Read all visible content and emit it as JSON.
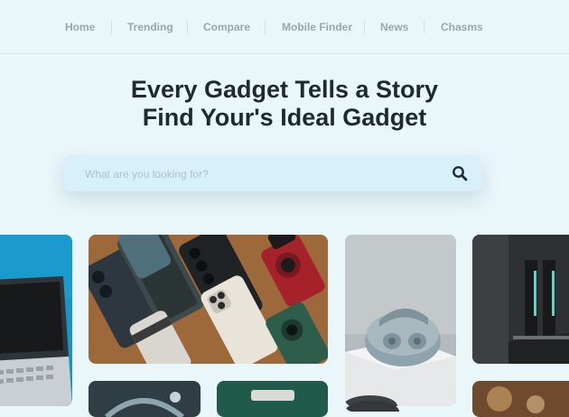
{
  "nav": {
    "items": [
      {
        "label": "Home"
      },
      {
        "label": "Trending"
      },
      {
        "label": "Compare"
      },
      {
        "label": "Mobile Finder"
      },
      {
        "label": "News"
      },
      {
        "label": "Chasms"
      }
    ]
  },
  "hero": {
    "line1": "Every Gadget Tells a Story",
    "line2": "Find Your's Ideal Gadget"
  },
  "search": {
    "placeholder": "What are you looking for?",
    "value": "",
    "icon": "search-icon"
  },
  "gallery": {
    "tiles": [
      {
        "subject": "laptop-image"
      },
      {
        "subject": "smartphones-collection-image"
      },
      {
        "subject": "wireless-earbuds-image"
      },
      {
        "subject": "gaming-gadget-image"
      },
      {
        "subject": "headphones-image"
      },
      {
        "subject": "green-device-image"
      },
      {
        "subject": "speaker-image"
      },
      {
        "subject": "product-image"
      }
    ]
  },
  "colors": {
    "background": "#e9f6fa",
    "search_background": "#d8f0fa",
    "heading": "#1f2a2f",
    "nav_text": "#9aa7ad"
  }
}
